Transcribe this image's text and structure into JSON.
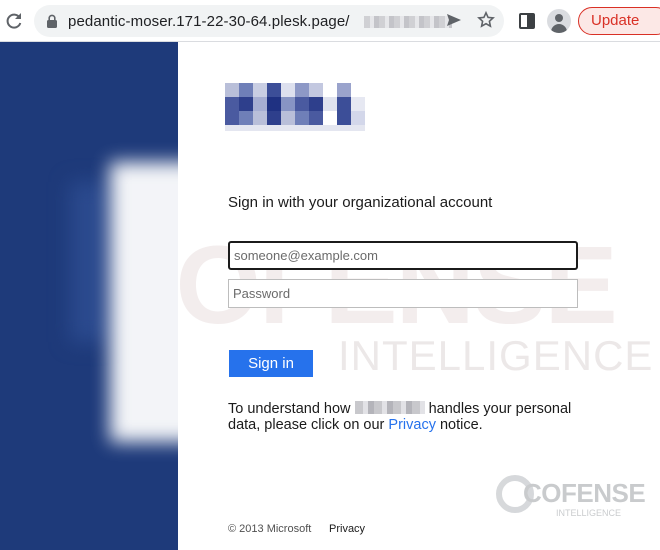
{
  "browser": {
    "url": "pedantic-moser.171-22-30-64.plesk.page/",
    "update_label": "Update",
    "icons": [
      "reload-icon",
      "lock-icon",
      "send-icon",
      "star-icon",
      "sidebar-icon",
      "profile-icon"
    ]
  },
  "watermark": {
    "line1": "COFENSE",
    "line2": "INTELLIGENCE"
  },
  "login": {
    "heading": "Sign in with your organizational account",
    "email_placeholder": "someone@example.com",
    "password_placeholder": "Password",
    "signin_label": "Sign in",
    "privacy_pre": "To understand how ",
    "privacy_mid": " handles your personal data, please click on our ",
    "privacy_link": "Privacy",
    "privacy_post": " notice."
  },
  "footer": {
    "copyright": "© 2013 Microsoft",
    "privacy": "Privacy"
  },
  "badge": {
    "name": "COFENSE",
    "sub": "INTELLIGENCE"
  },
  "colors": {
    "brand_panel": "#1e3a7a",
    "signin_button": "#2672ec",
    "update_accent": "#d93025"
  }
}
